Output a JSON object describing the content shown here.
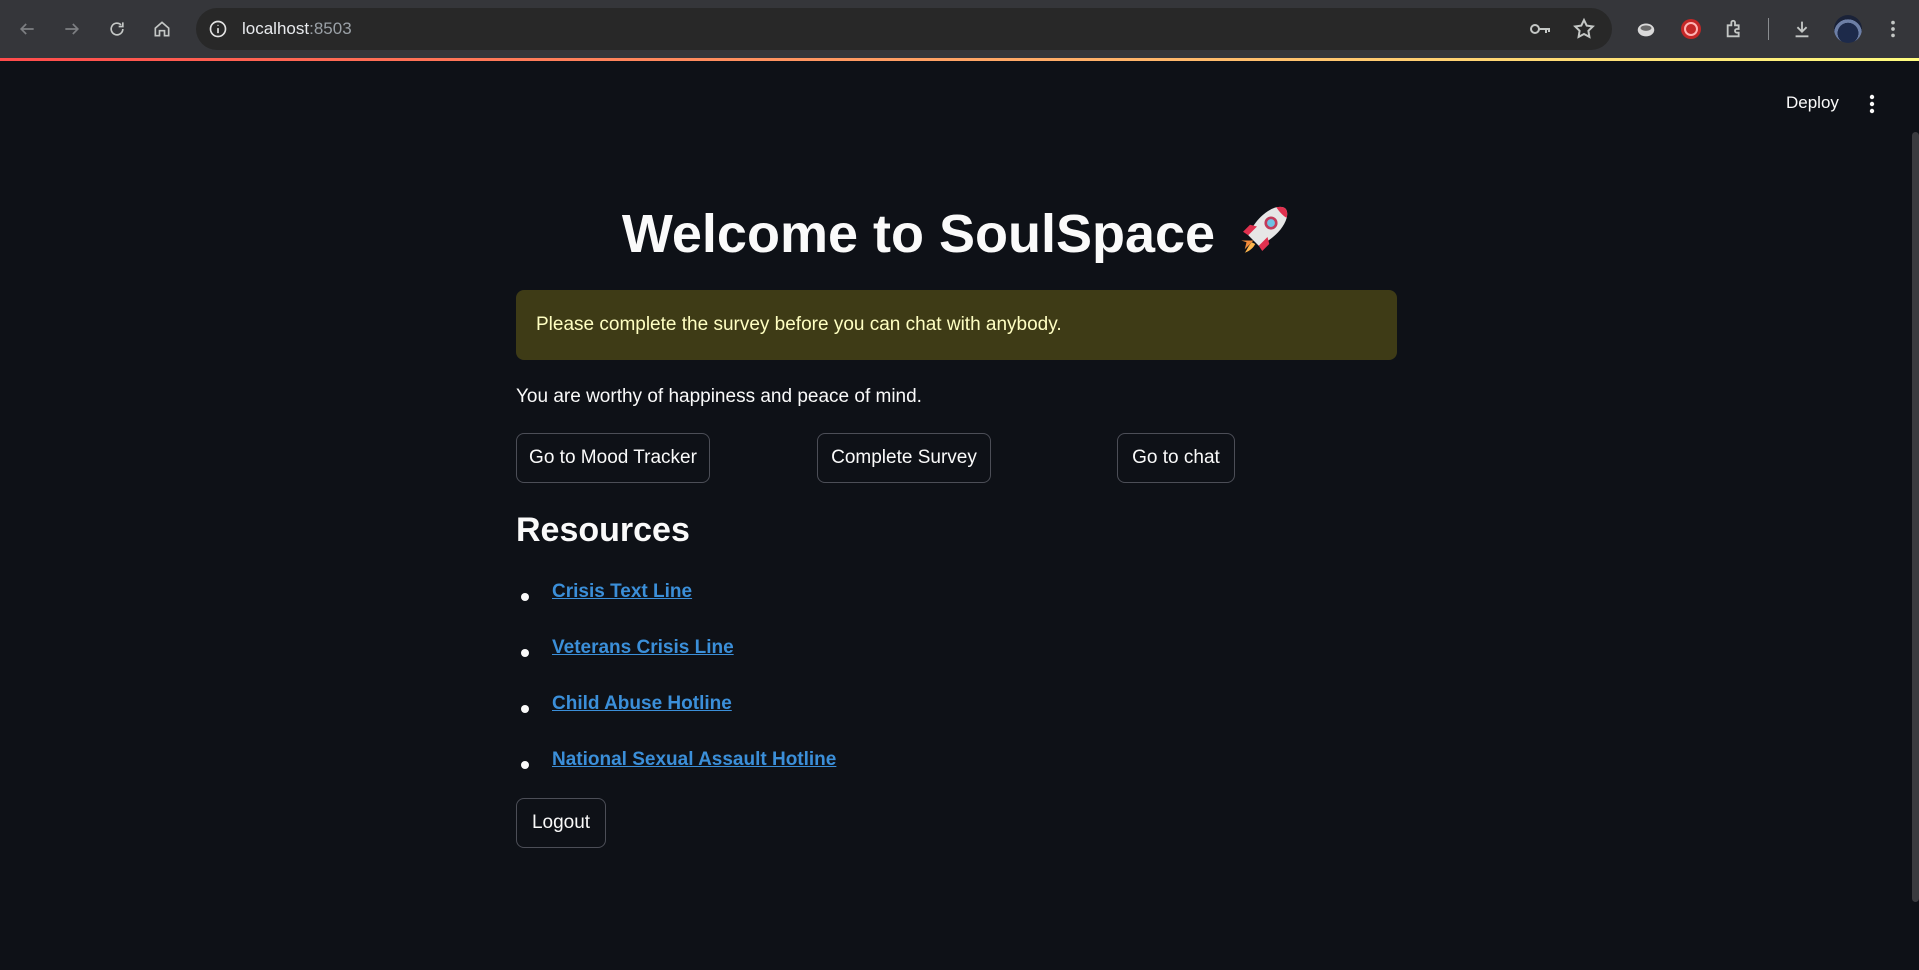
{
  "browser": {
    "url_host": "localhost",
    "url_port": ":8503"
  },
  "header": {
    "deploy_label": "Deploy"
  },
  "main": {
    "title": "Welcome to SoulSpace",
    "warning": "Please complete the survey before you can chat with anybody.",
    "affirmation": "You are worthy of happiness and peace of mind.",
    "buttons": {
      "mood_tracker": "Go to Mood Tracker",
      "survey": "Complete Survey",
      "chat": "Go to chat"
    },
    "resources": {
      "heading": "Resources",
      "links": [
        "Crisis Text Line",
        "Veterans Crisis Line",
        "Child Abuse Hotline",
        "National Sexual Assault Hotline"
      ]
    },
    "logout_label": "Logout"
  },
  "colors": {
    "background": "#0e1117",
    "warning_bg": "#3e3b16",
    "warning_text": "#ffffc2",
    "link": "#3b8fd9",
    "accent_start": "#ff4b4b",
    "accent_end": "#fffd80"
  }
}
